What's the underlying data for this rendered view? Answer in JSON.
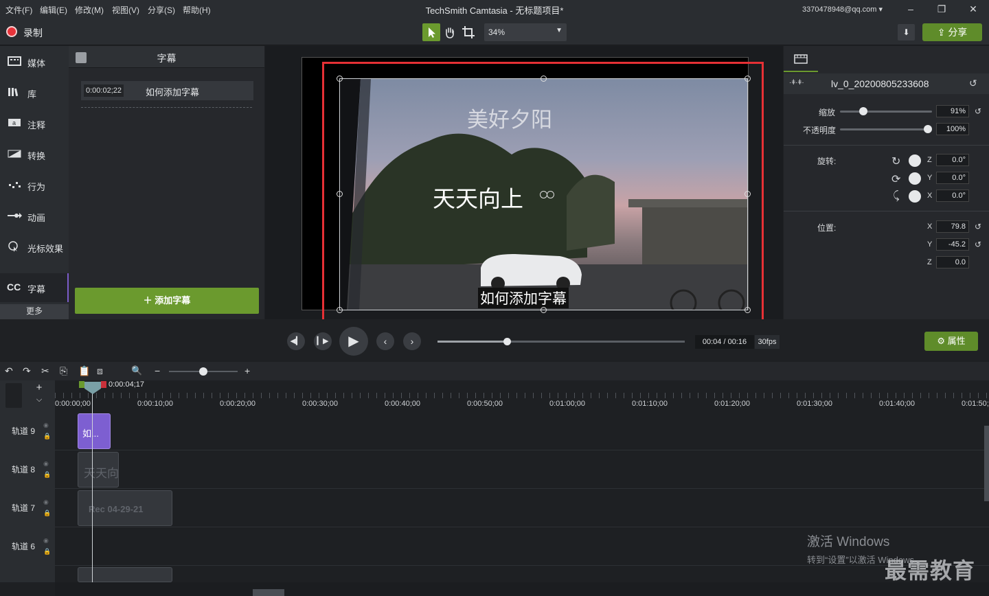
{
  "menu": {
    "file": "文件(F)",
    "edit": "编辑(E)",
    "modify": "修改(M)",
    "view": "视图(V)",
    "share": "分享(S)",
    "help": "帮助(H)"
  },
  "app_title": "TechSmith Camtasia - 无标题项目*",
  "account": "3370478948@qq.com",
  "toolbar": {
    "record": "录制",
    "zoom": "34%",
    "share": "分享"
  },
  "nav": {
    "items": [
      {
        "label": "媒体",
        "icon": "media-icon"
      },
      {
        "label": "库",
        "icon": "library-icon"
      },
      {
        "label": "注释",
        "icon": "annotation-icon"
      },
      {
        "label": "转换",
        "icon": "transition-icon"
      },
      {
        "label": "行为",
        "icon": "behavior-icon"
      },
      {
        "label": "动画",
        "icon": "animation-icon"
      },
      {
        "label": "光标效果",
        "icon": "cursor-effect-icon"
      }
    ],
    "captions": "字幕",
    "more": "更多"
  },
  "captions_panel": {
    "title": "字幕",
    "entry_time": "0:00:02;22",
    "entry_text": "如何添加字幕",
    "add_button": "添加字幕"
  },
  "canvas": {
    "title_text": "美好夕阳",
    "overlay_text": "天天向上",
    "subtitle_text": "如何添加字幕"
  },
  "properties": {
    "clip_name": "lv_0_20200805233608",
    "scale_label": "缩放",
    "scale_value": "91%",
    "scale_level": 0.25,
    "opacity_label": "不透明度",
    "opacity_value": "100%",
    "opacity_level": 1.0,
    "rotation_label": "旋转:",
    "rot_z": "0.0°",
    "rot_y": "0.0°",
    "rot_x": "0.0°",
    "position_label": "位置:",
    "pos_x": "79.8",
    "pos_y": "-45.2",
    "pos_z": "0.0",
    "axis_z": "Z",
    "axis_y": "Y",
    "axis_x": "X"
  },
  "playback": {
    "timecode": "00:04 / 00:16",
    "fps": "30fps",
    "properties_button": "属性",
    "progress": 0.28
  },
  "timeline": {
    "playhead_time": "0:00:04;17",
    "ticks": [
      "0:00:00;00",
      "0:00:10;00",
      "0:00:20;00",
      "0:00:30;00",
      "0:00:40;00",
      "0:00:50;00",
      "0:01:00;00",
      "0:01:10;00",
      "0:01:20;00",
      "0:01:30;00",
      "0:01:40;00",
      "0:01:50;"
    ],
    "tracks": [
      {
        "label": "轨道 9",
        "clip": "如..."
      },
      {
        "label": "轨道 8",
        "clip": "天天向"
      },
      {
        "label": "轨道 7",
        "clip": "Rec 04-29-21"
      },
      {
        "label": "轨道 6",
        "clip": ""
      }
    ]
  },
  "watermark": {
    "line1": "激活 Windows",
    "line2": "转到“设置”以激活 Windows。",
    "brand": "最需教育"
  }
}
